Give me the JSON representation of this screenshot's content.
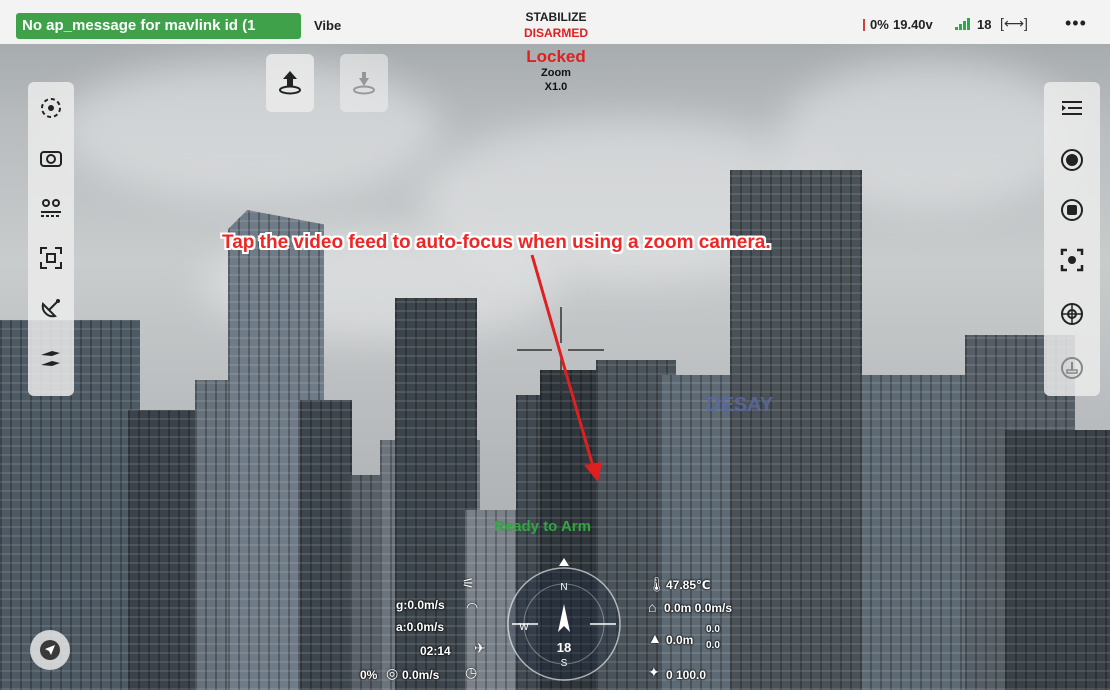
{
  "status_bar": {
    "message": "No ap_message for mavlink id (1",
    "vehicle_name": "Vibe",
    "flight_mode": "STABILIZE",
    "arm_state": "DISARMED",
    "battery_percent": "0%",
    "voltage": "19.40v",
    "satellite_count": "18",
    "more_label": "•••"
  },
  "overlay": {
    "lock_state": "Locked",
    "zoom_label": "Zoom",
    "zoom_value": "X1.0",
    "annotation": "Tap the video feed to auto-focus when using a zoom camera.",
    "ready_state": "Ready to Arm"
  },
  "left_toolbar": [
    "target-center-icon",
    "camera-switch-icon",
    "waypoints-icon",
    "focus-frame-icon",
    "satellite-dish-icon",
    "takeoff-landing-icon"
  ],
  "right_toolbar": [
    "menu-list-icon",
    "record-icon",
    "stop-record-icon",
    "capture-focus-icon",
    "wheel-icon",
    "power-download-icon"
  ],
  "telemetry": {
    "ground_speed": "g:0.0m/s",
    "air_speed": "a:0.0m/s",
    "flight_time": "02:14",
    "throttle": "0%",
    "climb_rate": "0.0m/s",
    "temperature": "47.85℃",
    "home_distance": "0.0m 0.0m/s",
    "altitude": "0.0m",
    "altitude_sub1": "0.0",
    "altitude_sub2": "0.0",
    "gps_hdop": "0 100.0",
    "heading": "18",
    "compass_n": "N",
    "compass_s": "S",
    "compass_w": "W"
  }
}
